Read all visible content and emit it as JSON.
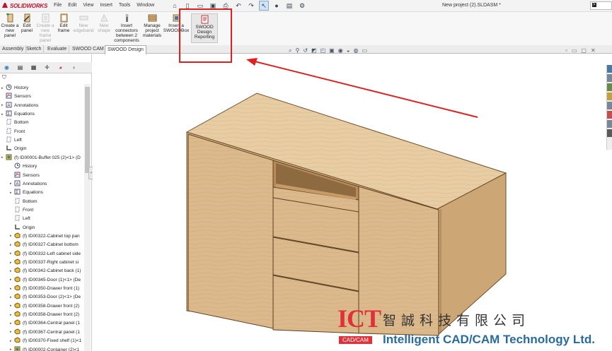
{
  "app": {
    "logo_text": "SOLIDWORKS",
    "document_title": "New project (2).SLDASM *",
    "search_glyph": ">"
  },
  "menu": [
    "File",
    "Edit",
    "View",
    "Insert",
    "Tools",
    "Window"
  ],
  "ribbon": {
    "create_panel": "Create a\nnew\npanel",
    "edit_panel": "Edit\npanel",
    "create_frame_panel": "Create a\nnew\nframe\npanel",
    "edit_frame": "Edit\nframe",
    "new_edgeband": "New\nedgeband",
    "new_shape": "New\nshape",
    "insert_connectors": "Insert\nconnectors\nbetween 2\ncomponents",
    "manage_materials": "Manage\nproject\nmaterials",
    "insert_swoodbox": "Insert a\nSWOODBox",
    "swood_design_reporting": "SWOOD\nDesign\nReporting"
  },
  "tabs": [
    "Assembly",
    "Sketch",
    "Evaluate",
    "SWOOD CAM",
    "SWOOD Design"
  ],
  "active_tab": "SWOOD Design",
  "tree": [
    {
      "label": "History",
      "icon": "history",
      "indent": 0,
      "arrow": true
    },
    {
      "label": "Sensors",
      "icon": "sensors",
      "indent": 0,
      "arrow": false
    },
    {
      "label": "Annotations",
      "icon": "annotations",
      "indent": 0,
      "arrow": true
    },
    {
      "label": "Equations",
      "icon": "equations",
      "indent": 0,
      "arrow": true
    },
    {
      "label": "Bottom",
      "icon": "plane",
      "indent": 0,
      "arrow": false
    },
    {
      "label": "Front",
      "icon": "plane",
      "indent": 0,
      "arrow": false
    },
    {
      "label": "Left",
      "icon": "plane",
      "indent": 0,
      "arrow": false
    },
    {
      "label": "Origin",
      "icon": "origin",
      "indent": 0,
      "arrow": false
    },
    {
      "label": "(f) ID00001-Buffet 025 (2)<1> (D",
      "icon": "assembly",
      "indent": 0,
      "arrow": true
    },
    {
      "label": "History",
      "icon": "history",
      "indent": 1,
      "arrow": false
    },
    {
      "label": "Sensors",
      "icon": "sensors",
      "indent": 1,
      "arrow": false
    },
    {
      "label": "Annotations",
      "icon": "annotations",
      "indent": 1,
      "arrow": true
    },
    {
      "label": "Equations",
      "icon": "equations",
      "indent": 1,
      "arrow": true
    },
    {
      "label": "Bottom",
      "icon": "plane",
      "indent": 1,
      "arrow": false
    },
    {
      "label": "Front",
      "icon": "plane",
      "indent": 1,
      "arrow": false
    },
    {
      "label": "Left",
      "icon": "plane",
      "indent": 1,
      "arrow": false
    },
    {
      "label": "Origin",
      "icon": "origin",
      "indent": 1,
      "arrow": false
    },
    {
      "label": "(f) ID00322-Cabinet top pan",
      "icon": "part",
      "indent": 1,
      "arrow": true
    },
    {
      "label": "(f) ID00327-Cabinet bottom",
      "icon": "part",
      "indent": 1,
      "arrow": true
    },
    {
      "label": "(f) ID00332-Left cabinet side",
      "icon": "part",
      "indent": 1,
      "arrow": true
    },
    {
      "label": "(f) ID00337-Right cabinet si",
      "icon": "part",
      "indent": 1,
      "arrow": true
    },
    {
      "label": "(f) ID00342-Cabinet back (1)",
      "icon": "part",
      "indent": 1,
      "arrow": true
    },
    {
      "label": "(f) ID00345-Door (1)<1> (De",
      "icon": "part",
      "indent": 1,
      "arrow": true
    },
    {
      "label": "(f) ID00350-Drawer front (1)",
      "icon": "part",
      "indent": 1,
      "arrow": true
    },
    {
      "label": "(f) ID00353-Door (2)<1> (De",
      "icon": "part",
      "indent": 1,
      "arrow": true
    },
    {
      "label": "(f) ID00358-Drawer front (2)",
      "icon": "part",
      "indent": 1,
      "arrow": true
    },
    {
      "label": "(f) ID00358-Drawer front (2)",
      "icon": "part",
      "indent": 1,
      "arrow": true
    },
    {
      "label": "(f) ID00364-Central panel (1",
      "icon": "part",
      "indent": 1,
      "arrow": true
    },
    {
      "label": "(f) ID00367-Central panel (1",
      "icon": "part",
      "indent": 1,
      "arrow": true
    },
    {
      "label": "(f) ID00370-Fixed shelf (1)<1",
      "icon": "part",
      "indent": 1,
      "arrow": true
    },
    {
      "label": "(f) ID00002-Container (2)<1",
      "icon": "assembly",
      "indent": 1,
      "arrow": true
    }
  ],
  "watermark": {
    "logo": "ICT",
    "logo_sub": "CAD/CAM",
    "chinese": "智誠科技有限公司",
    "english": "Intelligent CAD/CAM Technology Ltd."
  },
  "colors": {
    "highlight": "#e02020",
    "wood_front": "#dcb98c",
    "wood_top": "#e8cda4",
    "wood_side": "#cda676",
    "brand_red": "#e0303a",
    "brand_blue": "#2a6b9f"
  }
}
